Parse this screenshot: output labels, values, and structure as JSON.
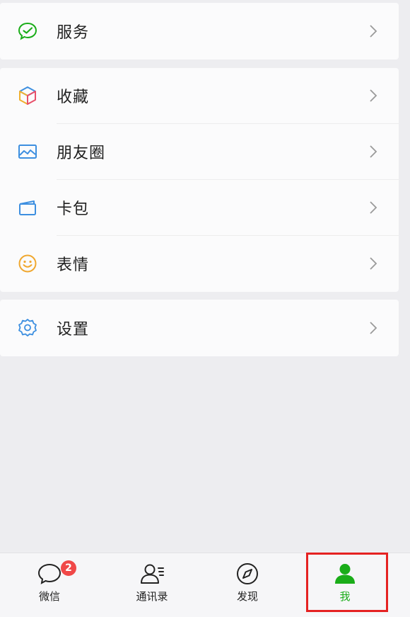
{
  "menu": {
    "services": {
      "label": "服务"
    },
    "favorites": {
      "label": "收藏"
    },
    "moments": {
      "label": "朋友圈"
    },
    "cards": {
      "label": "卡包"
    },
    "stickers": {
      "label": "表情"
    },
    "settings": {
      "label": "设置"
    }
  },
  "tabbar": {
    "tabs": [
      {
        "label": "微信",
        "icon": "chat-bubble-icon",
        "badge": "2"
      },
      {
        "label": "通讯录",
        "icon": "contacts-icon"
      },
      {
        "label": "发现",
        "icon": "compass-icon"
      },
      {
        "label": "我",
        "icon": "person-icon",
        "active": true
      }
    ]
  },
  "colors": {
    "accent_green": "#1aad19",
    "badge_red": "#f04848",
    "highlight_red": "#e52222",
    "background": "#ededf0",
    "card": "#fbfbfc"
  }
}
